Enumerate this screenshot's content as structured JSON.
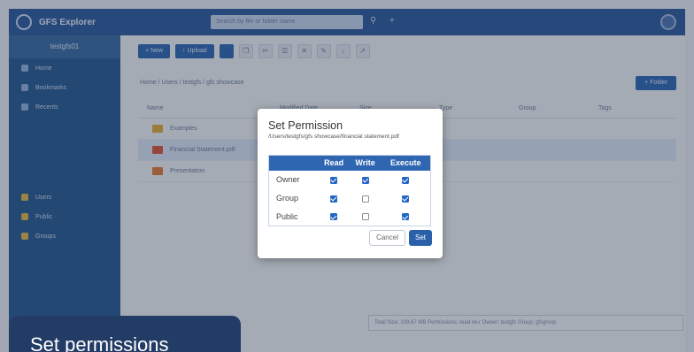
{
  "app": {
    "title": "GFS Explorer",
    "search_placeholder": "Search by file or folder name",
    "user": "testgfs01"
  },
  "sidebar": {
    "items": [
      {
        "label": "Home"
      },
      {
        "label": "Bookmarks"
      },
      {
        "label": "Recents"
      }
    ],
    "groups": [
      {
        "label": "Users"
      },
      {
        "label": "Public"
      },
      {
        "label": "Groups"
      }
    ]
  },
  "toolbar": {
    "new_label": "+ New",
    "upload_label": "↑ Upload"
  },
  "breadcrumb": "Home / Users / testgfs / gfs showcase",
  "folder_button": "+ Folder",
  "table": {
    "headers": [
      "Name",
      "Modified Date",
      "Size",
      "Type",
      "Group",
      "Tags"
    ],
    "rows": [
      {
        "name": "Examples",
        "date": "",
        "size": "",
        "type": "",
        "group": "",
        "tags": ""
      },
      {
        "name": "Financial Statement.pdf",
        "date": "",
        "size": "",
        "type": "",
        "group": "",
        "tags": ""
      },
      {
        "name": "Presentation",
        "date": "",
        "size": "",
        "type": "",
        "group": "",
        "tags": ""
      }
    ]
  },
  "status": "Total Size: 109.87 MB  Permissions: read rw-r  Owner: testgfs  Group: gfsgroup",
  "dialog": {
    "title": "Set Permission",
    "path": "/Users/testgfs/gfs showcase/financial statement.pdf",
    "columns": [
      "Read",
      "Write",
      "Execute"
    ],
    "rows": [
      {
        "role": "Owner",
        "read": true,
        "write": true,
        "execute": true
      },
      {
        "role": "Group",
        "read": true,
        "write": false,
        "execute": true
      },
      {
        "role": "Public",
        "read": true,
        "write": false,
        "execute": true
      }
    ],
    "cancel_label": "Cancel",
    "set_label": "Set"
  },
  "caption": "Set permissions",
  "colors": {
    "accent": "#2f66b2",
    "caption_bg": "#233c66",
    "checkbox": "#2466c4"
  }
}
